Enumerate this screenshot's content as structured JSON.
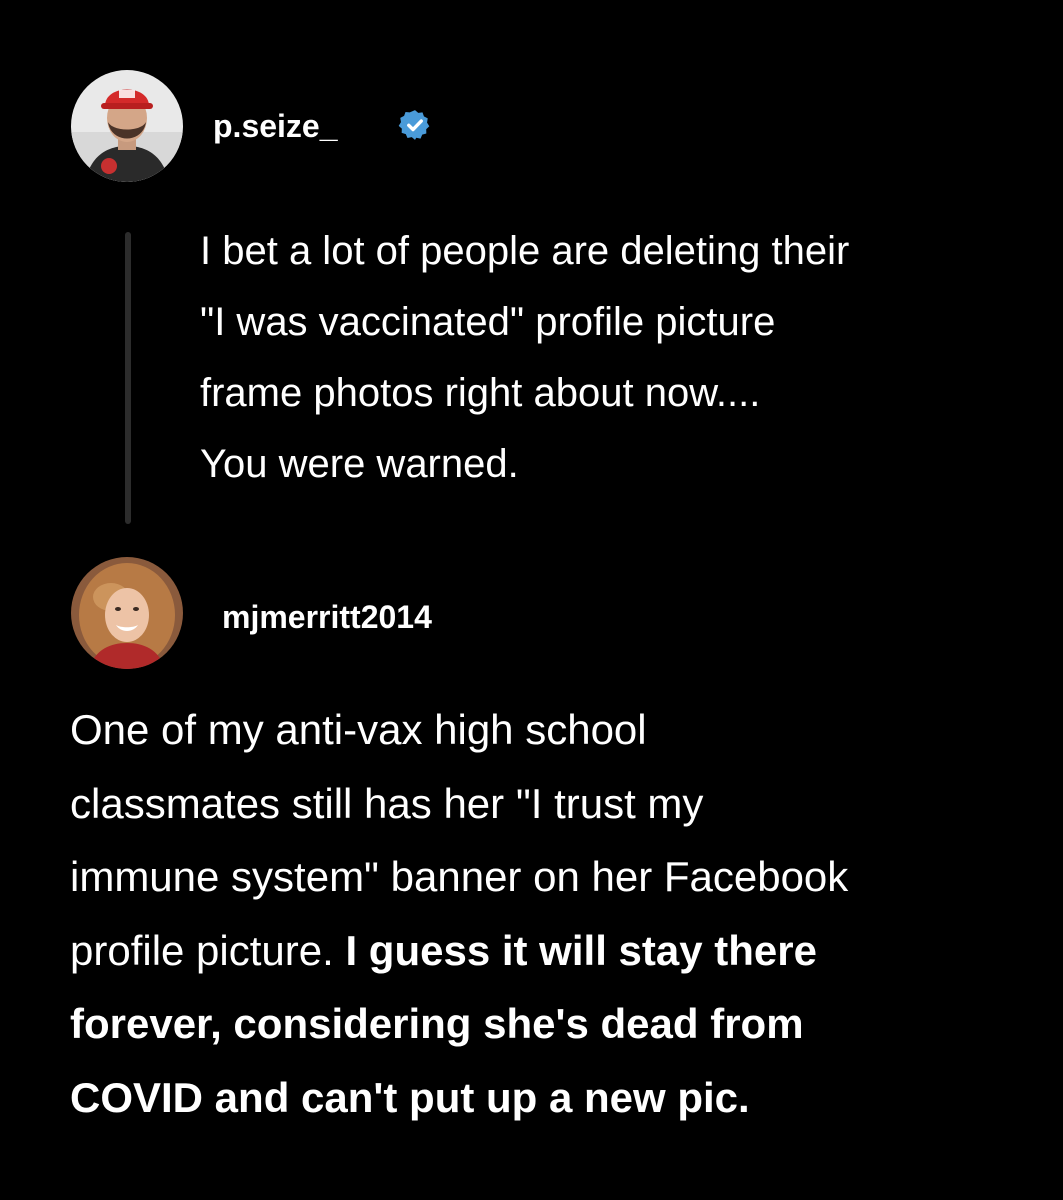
{
  "post": {
    "username": "p.seize_",
    "verified": true,
    "lines": [
      "I bet a lot of people are deleting their",
      "\"I was vaccinated\" profile picture",
      "frame photos right about now....",
      "You were warned."
    ]
  },
  "reply": {
    "username": "mjmerritt2014",
    "lines": [
      {
        "normal": "One of my anti-vax high school",
        "bold": ""
      },
      {
        "normal": "classmates still has her \"I trust my",
        "bold": ""
      },
      {
        "normal": "immune system\" banner on her Facebook",
        "bold": ""
      },
      {
        "normal": "profile picture. ",
        "bold": "I guess it will stay there"
      },
      {
        "normal": "",
        "bold": "forever, considering she's dead from"
      },
      {
        "normal": "",
        "bold": "COVID and can't put up a new pic."
      }
    ]
  },
  "colors": {
    "background": "#000000",
    "text": "#ffffff",
    "verified_badge": "#4a9bd9",
    "thread_line": "#2c2c2c"
  },
  "icons": {
    "verified": "verified-badge-icon"
  }
}
